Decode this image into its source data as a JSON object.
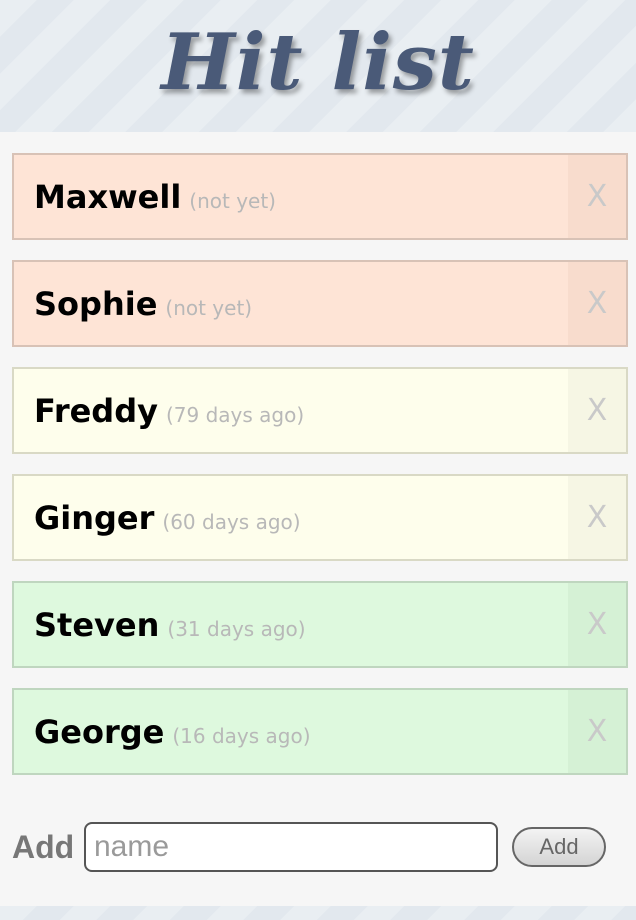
{
  "header": {
    "title": "Hit list"
  },
  "items": [
    {
      "name": "Maxwell",
      "ago": "(not yet)",
      "status": "red",
      "delete_label": "X"
    },
    {
      "name": "Sophie",
      "ago": "(not yet)",
      "status": "red",
      "delete_label": "X"
    },
    {
      "name": "Freddy",
      "ago": "(79 days ago)",
      "status": "yellow",
      "delete_label": "X"
    },
    {
      "name": "Ginger",
      "ago": "(60 days ago)",
      "status": "yellow",
      "delete_label": "X"
    },
    {
      "name": "Steven",
      "ago": "(31 days ago)",
      "status": "green",
      "delete_label": "X"
    },
    {
      "name": "George",
      "ago": "(16 days ago)",
      "status": "green",
      "delete_label": "X"
    }
  ],
  "add": {
    "label": "Add",
    "placeholder": "name",
    "value": "",
    "button_label": "Add"
  },
  "colors": {
    "title": "#4a5a78",
    "red": "#fee4d6",
    "yellow": "#fefeec",
    "green": "#def9de"
  }
}
